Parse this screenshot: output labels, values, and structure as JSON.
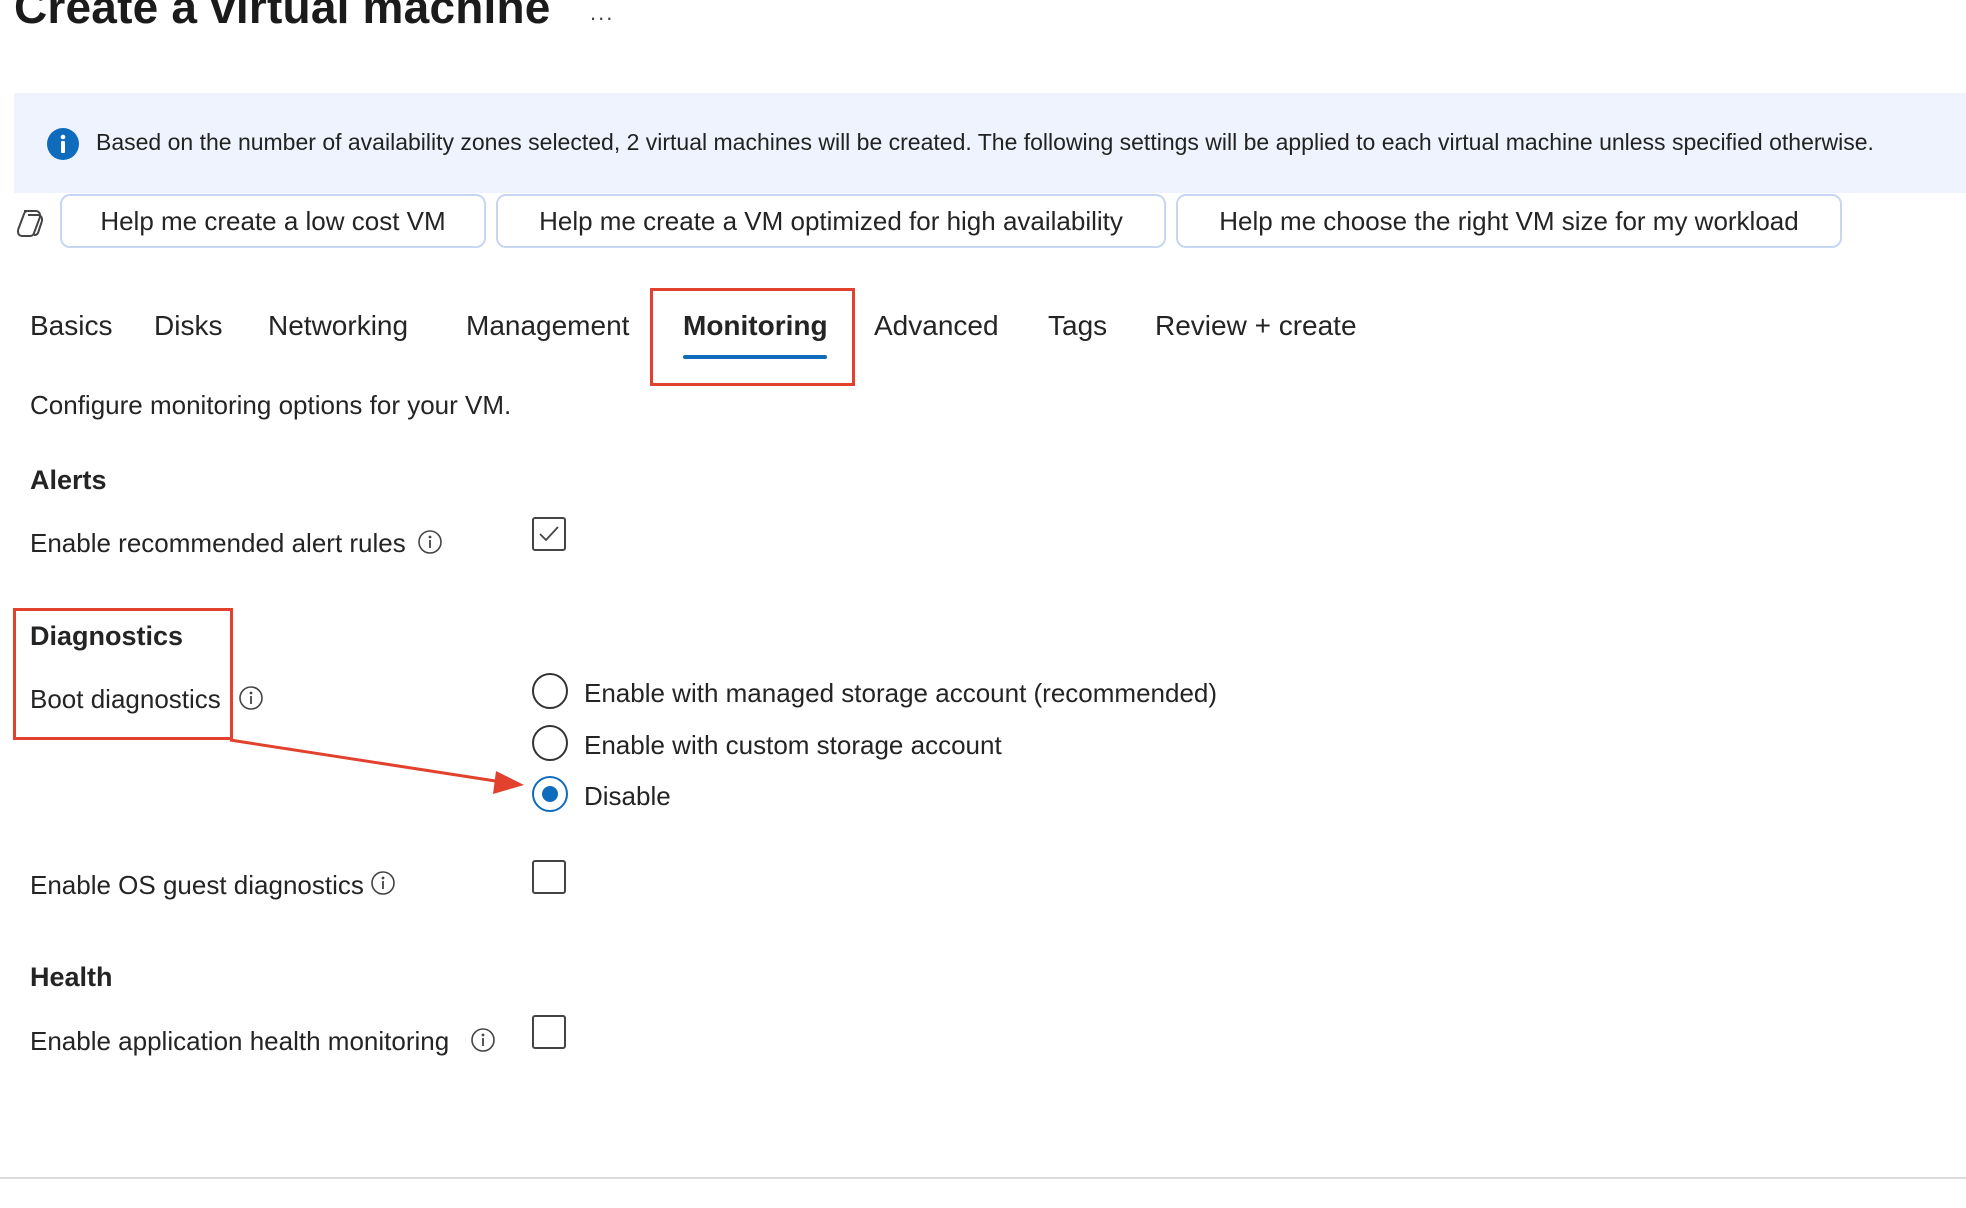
{
  "header": {
    "title": "Create a virtual machine",
    "more_label": "..."
  },
  "info_banner": {
    "icon": "info-icon",
    "text": "Based on the number of availability zones selected, 2 virtual machines will be created. The following settings will be applied to each virtual machine unless specified otherwise."
  },
  "copilot": {
    "icon": "copilot-icon",
    "prompts": [
      "Help me create a low cost VM",
      "Help me create a VM optimized for high availability",
      "Help me choose the right VM size for my workload"
    ]
  },
  "tabs": {
    "items": [
      "Basics",
      "Disks",
      "Networking",
      "Management",
      "Monitoring",
      "Advanced",
      "Tags",
      "Review + create"
    ],
    "active": "Monitoring"
  },
  "monitoring": {
    "description": "Configure monitoring options for your VM.",
    "alerts": {
      "heading": "Alerts",
      "recommended_rules_label": "Enable recommended alert rules",
      "recommended_rules_checked": true
    },
    "diagnostics": {
      "heading": "Diagnostics",
      "boot_label": "Boot diagnostics",
      "boot_options": [
        "Enable with managed storage account (recommended)",
        "Enable with custom storage account",
        "Disable"
      ],
      "boot_selected": "Disable",
      "os_guest_label": "Enable OS guest diagnostics",
      "os_guest_checked": false
    },
    "health": {
      "heading": "Health",
      "app_health_label": "Enable application health monitoring",
      "app_health_checked": false
    }
  },
  "colors": {
    "accent": "#0f6cbd",
    "annotation": "#e2412d",
    "banner_bg": "#eef3fd"
  }
}
